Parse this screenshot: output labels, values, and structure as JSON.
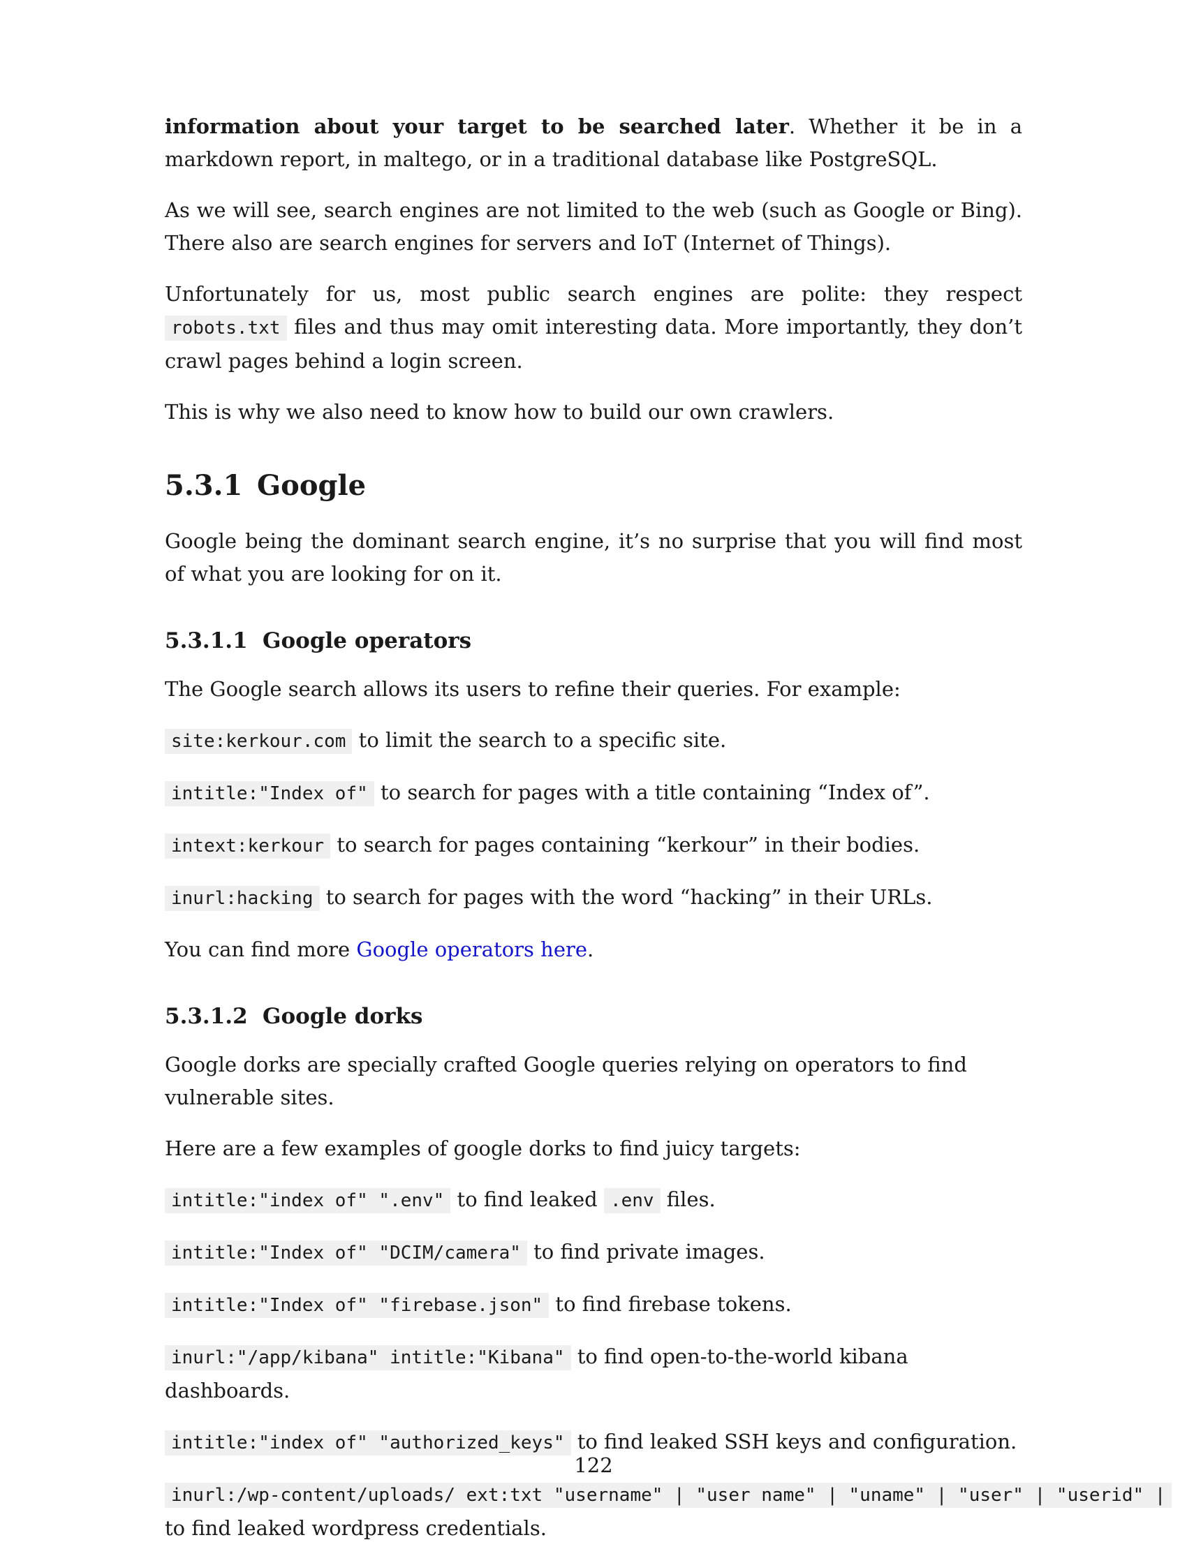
{
  "paragraphs": {
    "p1_bold": "information about your target to be searched later",
    "p1_rest": ". Whether it be in a markdown report, in maltego, or in a traditional database like PostgreSQL.",
    "p2": "As we will see, search engines are not limited to the web (such as Google or Bing). There also are search engines for servers and IoT (Internet of Things).",
    "p3_a": "Unfortunately for us, most public search engines are polite: they respect ",
    "p3_code": "robots.txt",
    "p3_b": " files and thus may omit interesting data. More importantly, they don’t crawl pages behind a login screen.",
    "p4": "This is why we also need to know how to build our own crawlers."
  },
  "section_google": {
    "number": "5.3.1",
    "title": "Google",
    "intro": "Google being the dominant search engine, it’s no surprise that you will find most of what you are looking for on it."
  },
  "subsection_operators": {
    "number": "5.3.1.1",
    "title": "Google operators",
    "intro": "The Google search allows its users to refine their queries. For example:",
    "items": [
      {
        "code": "site:kerkour.com",
        "text": " to limit the search to a specific site."
      },
      {
        "code": "intitle:\"Index of\"",
        "text": " to search for pages with a title containing “Index of”."
      },
      {
        "code": "intext:kerkour",
        "text": " to search for pages containing “kerkour” in their bodies."
      },
      {
        "code": "inurl:hacking",
        "text": " to search for pages with the word “hacking” in their URLs."
      }
    ],
    "more_prefix": "You can find more ",
    "more_link": "Google operators here",
    "more_suffix": "."
  },
  "subsection_dorks": {
    "number": "5.3.1.2",
    "title": "Google dorks",
    "intro1": "Google dorks are specially crafted Google queries relying on operators to find vulnerable sites.",
    "intro2": "Here are a few examples of google dorks to find juicy targets:",
    "env_code": "intitle:\"index of\" \".env\"",
    "env_text_a": " to find leaked ",
    "env_code2": ".env",
    "env_text_b": " files.",
    "items": [
      {
        "code": "intitle:\"Index of\" \"DCIM/camera\"",
        "text": " to find private images."
      },
      {
        "code": "intitle:\"Index of\" \"firebase.json\"",
        "text": " to find firebase tokens."
      },
      {
        "code": "inurl:\"/app/kibana\" intitle:\"Kibana\"",
        "text": " to find open-to-the-world kibana dashboards."
      },
      {
        "code": "intitle:\"index of\" \"authorized_keys\"",
        "text": " to find leaked SSH keys and configuration."
      }
    ],
    "wp_code": "inurl:/wp-content/uploads/ ext:txt \"username\" | \"user name\" | \"uname\" | \"user\" | \"userid\" |",
    "wp_text": "to find leaked wordpress credentials."
  },
  "page_number": "122"
}
